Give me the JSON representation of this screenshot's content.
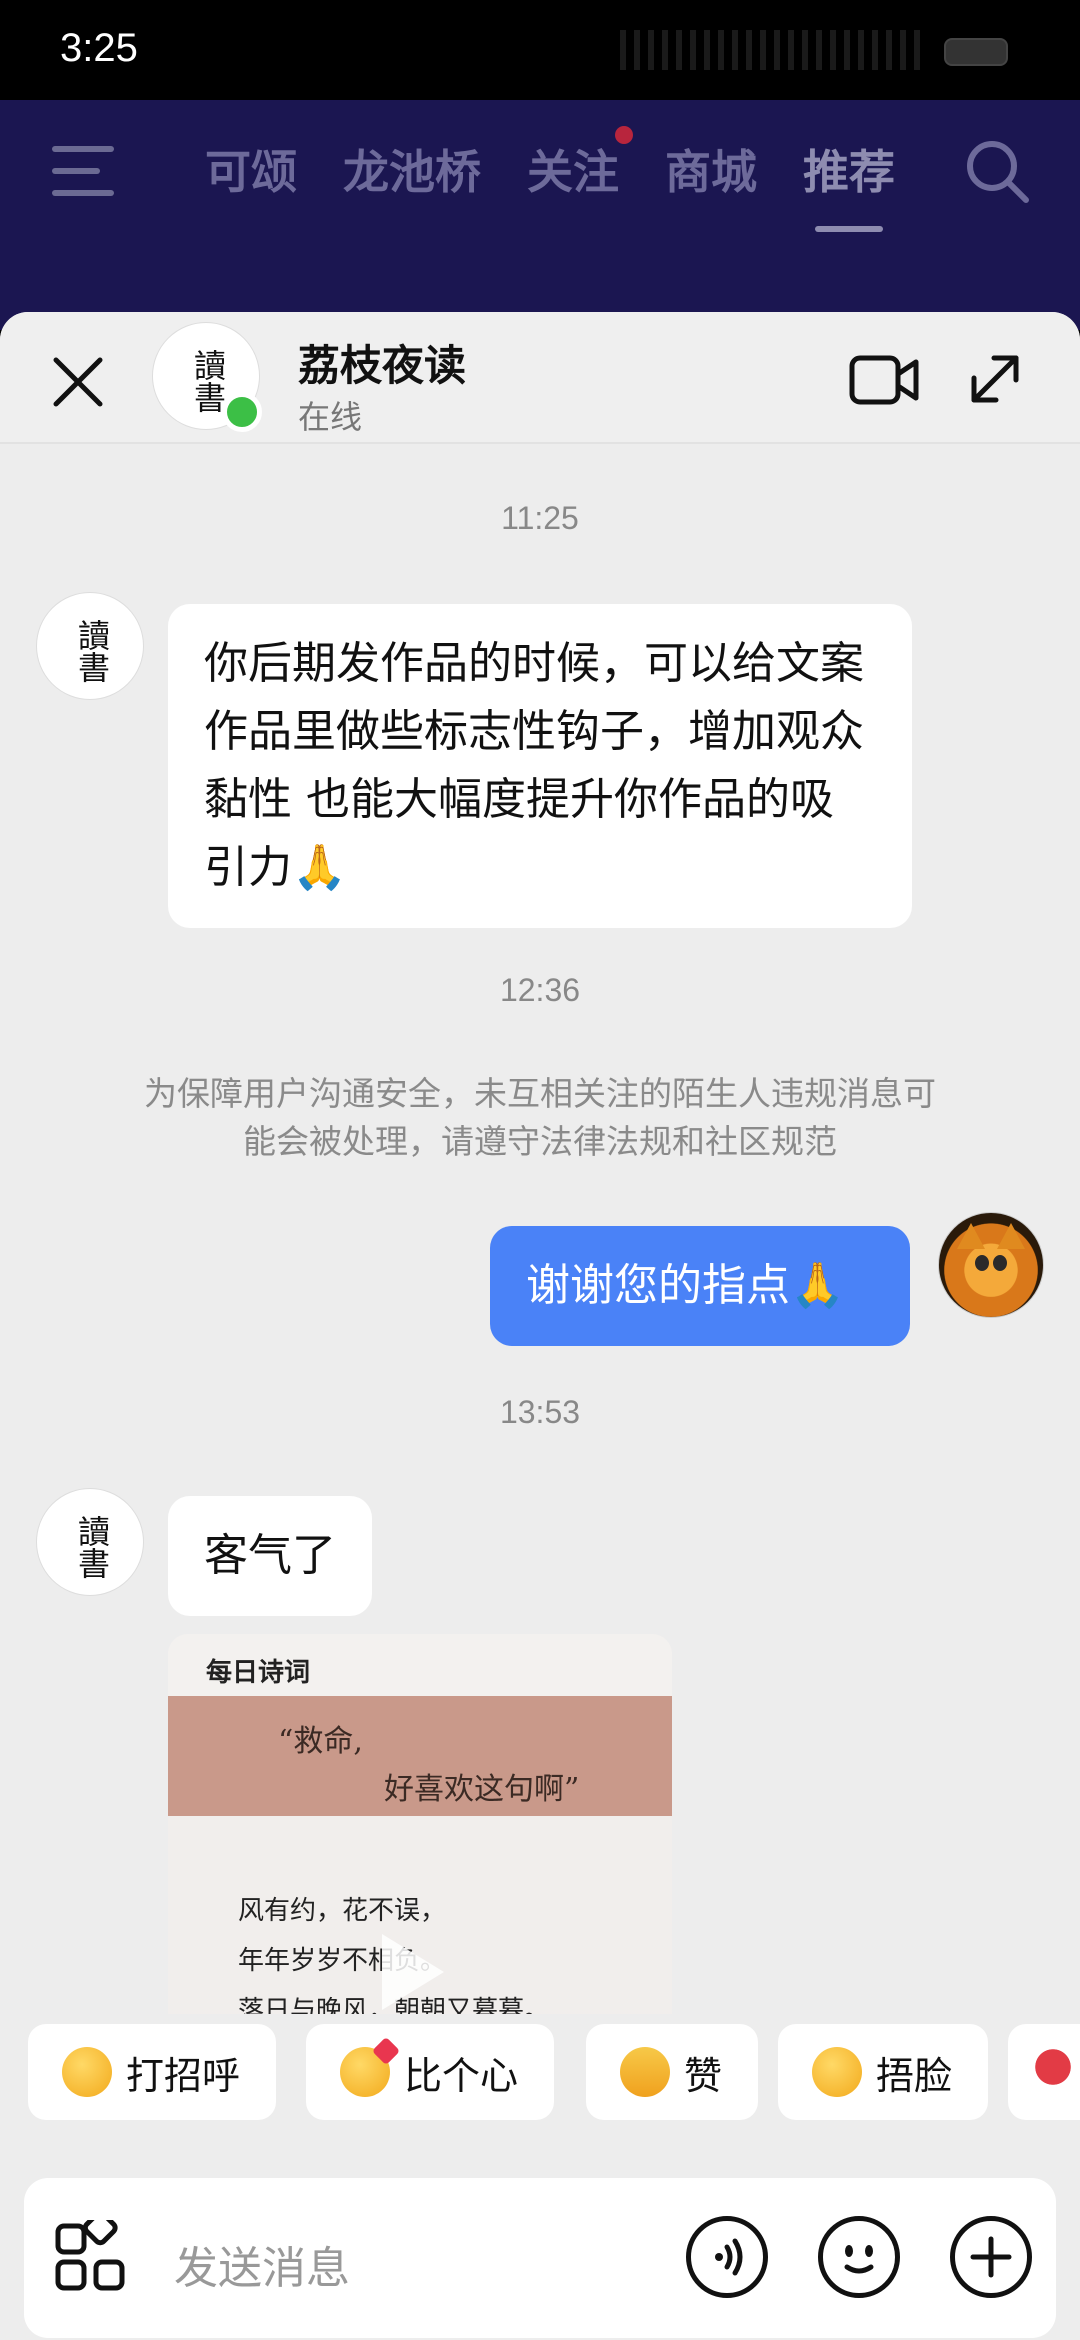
{
  "status_bar": {
    "time": "3:25"
  },
  "top_nav": {
    "tabs": [
      "可颂",
      "龙池桥",
      "关注",
      "商城",
      "推荐"
    ],
    "active_tab": "推荐",
    "menu_icon": "menu-icon",
    "search_icon": "search-icon"
  },
  "chat_header": {
    "name": "荔枝夜读",
    "status": "在线",
    "avatar_text": "讀書",
    "icons": [
      "close-icon",
      "video-call-icon",
      "expand-icon"
    ]
  },
  "messages": [
    {
      "timestamp": "11:25"
    },
    {
      "side": "left",
      "text": "你后期发作品的时候，可以给文案作品里做些标志性钩子，增加观众黏性 也能大幅度提升你作品的吸引力🙏"
    },
    {
      "timestamp": "12:36"
    },
    {
      "notice": "为保障用户沟通安全，未互相关注的陌生人违规消息可能会被处理，请遵守法律法规和社区规范"
    },
    {
      "side": "right",
      "text": "谢谢您的指点🙏"
    },
    {
      "timestamp": "13:53"
    },
    {
      "side": "left",
      "text": "客气了"
    }
  ],
  "video_card": {
    "header": "每日诗词",
    "quote_line1": "“救命,",
    "quote_line2": "好喜欢这句啊”",
    "poem": [
      "风有约，花不误，",
      "年年岁岁不相负。",
      "落日与晚风，朝朝又暮暮。"
    ]
  },
  "quick_replies": [
    "打招呼",
    "比个心",
    "赞",
    "捂脸"
  ],
  "input": {
    "placeholder": "发送消息",
    "icons": [
      "apps-icon",
      "voice-icon",
      "emoji-icon",
      "plus-icon"
    ]
  },
  "colors": {
    "accent": "#4a82f7",
    "online": "#3cbf46",
    "nav_bg": "#1b1651"
  }
}
